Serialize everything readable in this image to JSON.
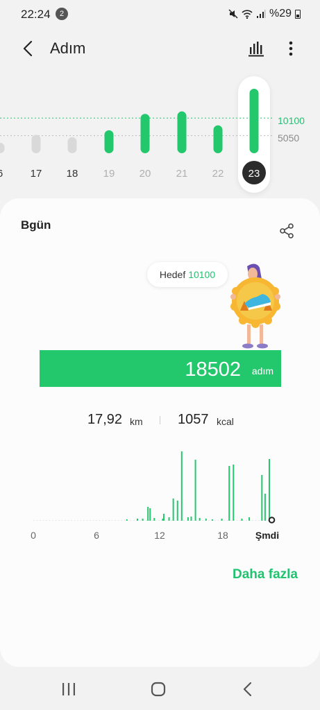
{
  "status_bar": {
    "time": "22:24",
    "notification_count": "2",
    "battery": "%29"
  },
  "app_bar": {
    "title": "Adım",
    "back_icon": "back-chevron-icon",
    "chart_icon": "bar-chart-icon",
    "more_icon": "more-vertical-icon"
  },
  "week_chart": {
    "goal_label": "10100",
    "mid_label": "5050",
    "days": [
      "6",
      "17",
      "18",
      "19",
      "20",
      "21",
      "22",
      "23"
    ],
    "selected_day": "23"
  },
  "chart_data": {
    "type": "bar",
    "categories": [
      "6",
      "17",
      "18",
      "19",
      "20",
      "21",
      "22",
      "23"
    ],
    "values": [
      3000,
      5300,
      4600,
      6600,
      11300,
      12000,
      8000,
      18502
    ],
    "goal": 10100,
    "mid": 5050,
    "colors": [
      "#d9d9d9",
      "#d9d9d9",
      "#d9d9d9",
      "#23c86d",
      "#23c86d",
      "#23c86d",
      "#23c86d",
      "#23c86d"
    ]
  },
  "card": {
    "title": "Bgün",
    "share_icon": "share-icon",
    "goal_label": "Hedef",
    "goal_value": "10100",
    "steps": "18502",
    "steps_unit": "adım",
    "distance": "17,92",
    "distance_unit": "km",
    "calories": "1057",
    "calories_unit": "kcal",
    "more_link": "Daha fazla"
  },
  "hour_chart": {
    "axis_labels": [
      "0",
      "6",
      "12",
      "18",
      "Şmdi"
    ],
    "max": 100,
    "bars": [
      {
        "h": 8.8,
        "v": 2
      },
      {
        "h": 9.8,
        "v": 3
      },
      {
        "h": 10.3,
        "v": 3
      },
      {
        "h": 10.8,
        "v": 20
      },
      {
        "h": 11.0,
        "v": 18
      },
      {
        "h": 11.4,
        "v": 4
      },
      {
        "h": 12.2,
        "v": 3
      },
      {
        "h": 12.3,
        "v": 10
      },
      {
        "h": 12.8,
        "v": 5
      },
      {
        "h": 13.2,
        "v": 32
      },
      {
        "h": 13.6,
        "v": 29
      },
      {
        "h": 14.0,
        "v": 100
      },
      {
        "h": 14.6,
        "v": 5
      },
      {
        "h": 14.9,
        "v": 6
      },
      {
        "h": 15.3,
        "v": 88
      },
      {
        "h": 15.7,
        "v": 4
      },
      {
        "h": 16.3,
        "v": 3
      },
      {
        "h": 16.9,
        "v": 2
      },
      {
        "h": 17.8,
        "v": 3
      },
      {
        "h": 18.5,
        "v": 79
      },
      {
        "h": 18.9,
        "v": 81
      },
      {
        "h": 19.7,
        "v": 3
      },
      {
        "h": 20.4,
        "v": 5
      },
      {
        "h": 21.6,
        "v": 66
      },
      {
        "h": 21.9,
        "v": 39
      },
      {
        "h": 22.3,
        "v": 89
      }
    ],
    "colors": {
      "bar": "#23c86d",
      "now_marker": "#222222"
    }
  },
  "nav_bar": {
    "recent_icon": "recent-apps-icon",
    "home_icon": "home-icon",
    "back_icon": "back-icon"
  }
}
